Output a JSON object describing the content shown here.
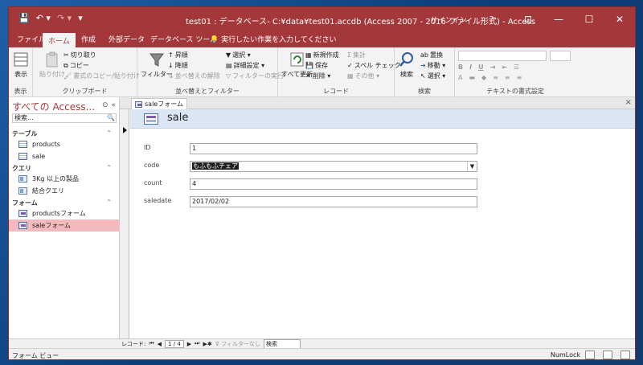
{
  "window": {
    "title": "test01 : データベース- C:¥data¥test01.accdb (Access 2007 - 2016 ファイル形式) - Access",
    "signin": "サインイン",
    "help": "?",
    "minimize": "—",
    "maximize": "☐",
    "close": "✕"
  },
  "qat": {
    "save": "💾",
    "undo": "↶ ▾",
    "redo": "↷ ▾",
    "customize": "▾"
  },
  "tabs": [
    "ファイル",
    "ホーム",
    "作成",
    "外部データ",
    "データベース ツール"
  ],
  "tellme": "実行したい作業を入力してください",
  "ribbon": {
    "groups": {
      "view": "表示",
      "clipboard": "クリップボード",
      "sort_filter": "並べ替えとフィルター",
      "records": "レコード",
      "find": "検索",
      "text_format": "テキストの書式設定"
    },
    "view_btn": "表示",
    "paste_btn": "貼り付け",
    "cut": "切り取り",
    "copy": "コピー",
    "format_painter": "書式のコピー/貼り付け",
    "filter_btn": "フィルター",
    "asc": "昇順",
    "desc": "降順",
    "remove_sort": "並べ替えの解除",
    "selection": "選択 ▾",
    "advanced": "詳細設定 ▾",
    "toggle_filter": "フィルターの実行",
    "refresh_all": "すべて更新",
    "new": "新規作成",
    "save": "保存",
    "delete": "削除 ▾",
    "totals": "集計",
    "spelling": "スペル チェック",
    "more": "その他 ▾",
    "find_btn": "検索",
    "replace": "置換",
    "goto": "移動 ▾",
    "select": "選択 ▾"
  },
  "nav": {
    "header": "すべての Access...",
    "search_placeholder": "検索...",
    "sections": [
      {
        "title": "テーブル",
        "items": [
          "products",
          "sale"
        ]
      },
      {
        "title": "クエリ",
        "items": [
          "3Kg 以上の製品",
          "結合クエリ"
        ]
      },
      {
        "title": "フォーム",
        "items": [
          "productsフォーム",
          "saleフォーム"
        ]
      }
    ]
  },
  "document": {
    "tab_label": "saleフォーム",
    "form_title": "sale",
    "fields": [
      {
        "label": "ID",
        "value": "1"
      },
      {
        "label": "code",
        "value": "もふもふチェア"
      },
      {
        "label": "count",
        "value": "4"
      },
      {
        "label": "saledate",
        "value": "2017/02/02"
      }
    ]
  },
  "recnav": {
    "label": "レコード:",
    "position": "1 / 4",
    "filter": "フィルターなし",
    "search": "検索"
  },
  "status": {
    "view_mode": "フォーム ビュー",
    "numlock": "NumLock"
  },
  "colors": {
    "accent": "#a4373a",
    "selection": "#f4b9bd",
    "form_header": "#dbe5f4"
  }
}
